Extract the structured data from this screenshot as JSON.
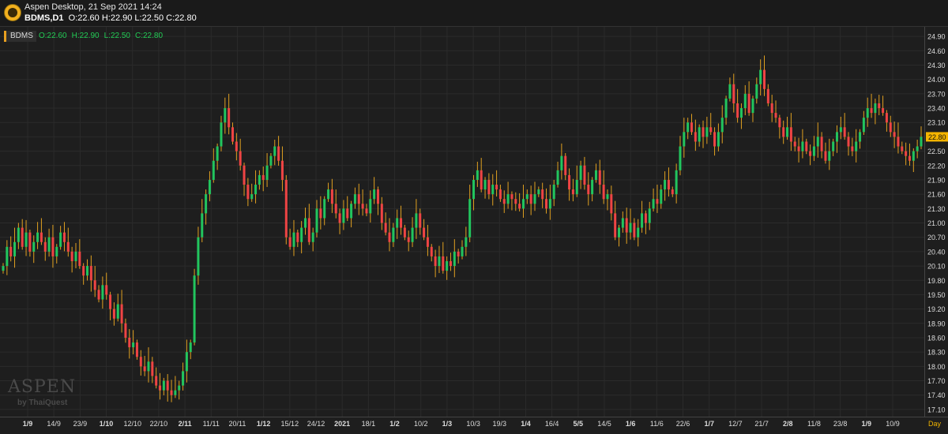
{
  "window": {
    "app_title": "Aspen Desktop, 21 Sep 2021 14:24",
    "symbol_tf": "BDMS,D1",
    "ohlc_text": "O:22.60 H:22.90 L:22.50 C:22.80"
  },
  "legend": {
    "symbol": "BDMS",
    "open": "O:22.60",
    "high": "H:22.90",
    "low": "L:22.50",
    "close": "C:22.80"
  },
  "watermark": {
    "brand": "ASPEN",
    "by": "by ThaiQuest"
  },
  "colors": {
    "up": "#22c55e",
    "down": "#ef4444",
    "wick": "#e0a020",
    "grid": "#2b2b2b",
    "last_price_bg": "#f5b400"
  },
  "chart_data": {
    "type": "candlestick",
    "title": "",
    "ylim": [
      16.95,
      25.1
    ],
    "y_ticks": [
      "24.90",
      "24.60",
      "24.30",
      "24.00",
      "23.70",
      "23.40",
      "23.10",
      "22.80",
      "22.50",
      "22.20",
      "21.90",
      "21.60",
      "21.30",
      "21.00",
      "20.70",
      "20.40",
      "20.10",
      "19.80",
      "19.50",
      "19.20",
      "18.90",
      "18.60",
      "18.30",
      "18.00",
      "17.70",
      "17.40",
      "17.10"
    ],
    "x_labels": [
      "1/9",
      "14/9",
      "23/9",
      "1/10",
      "12/10",
      "22/10",
      "2/11",
      "11/11",
      "20/11",
      "1/12",
      "15/12",
      "24/12",
      "2021",
      "18/1",
      "1/2",
      "10/2",
      "1/3",
      "10/3",
      "19/3",
      "1/4",
      "16/4",
      "5/5",
      "14/5",
      "1/6",
      "11/6",
      "22/6",
      "1/7",
      "12/7",
      "21/7",
      "2/8",
      "11/8",
      "23/8",
      "1/9",
      "10/9",
      "Day"
    ],
    "bold_labels": [
      "1/10",
      "2/11",
      "1/12",
      "2021",
      "1/2",
      "1/3",
      "1/4",
      "5/5",
      "1/6",
      "1/7",
      "2/8",
      "1/9"
    ],
    "last_price": "22.80",
    "closes": [
      20.1,
      20.5,
      20.3,
      20.6,
      20.9,
      20.5,
      20.8,
      20.4,
      20.6,
      20.8,
      20.6,
      20.4,
      20.7,
      20.3,
      20.5,
      20.8,
      20.6,
      20.4,
      20.2,
      20.4,
      20.1,
      19.9,
      20.1,
      19.8,
      19.6,
      19.4,
      19.7,
      19.5,
      19.2,
      19.0,
      19.3,
      18.9,
      18.6,
      18.4,
      18.5,
      18.2,
      18.0,
      17.9,
      18.1,
      17.8,
      17.6,
      17.5,
      17.7,
      17.5,
      17.4,
      17.5,
      17.6,
      17.9,
      18.3,
      18.5,
      19.9,
      20.7,
      21.2,
      21.6,
      21.9,
      22.3,
      22.6,
      23.1,
      23.4,
      23.0,
      22.7,
      22.5,
      22.2,
      21.8,
      21.5,
      21.6,
      21.8,
      22.0,
      21.9,
      22.2,
      22.4,
      22.6,
      22.3,
      21.9,
      20.7,
      20.5,
      20.8,
      20.6,
      20.9,
      21.1,
      20.6,
      20.8,
      21.3,
      21.1,
      21.5,
      21.7,
      21.4,
      21.2,
      21.0,
      21.3,
      21.1,
      21.4,
      21.6,
      21.4,
      21.3,
      21.2,
      21.5,
      21.7,
      21.4,
      21.0,
      20.8,
      20.6,
      20.9,
      21.1,
      20.9,
      20.7,
      20.6,
      20.9,
      21.2,
      20.9,
      20.7,
      20.5,
      20.3,
      20.1,
      20.3,
      20.0,
      20.2,
      20.1,
      20.4,
      20.3,
      20.5,
      20.7,
      21.5,
      21.9,
      22.1,
      21.7,
      21.9,
      21.6,
      21.8,
      21.7,
      21.5,
      21.4,
      21.6,
      21.5,
      21.4,
      21.3,
      21.5,
      21.6,
      21.4,
      21.6,
      21.7,
      21.5,
      21.3,
      21.5,
      21.8,
      22.1,
      22.4,
      22.0,
      21.7,
      21.6,
      21.9,
      22.2,
      21.8,
      21.6,
      21.9,
      22.1,
      21.8,
      21.5,
      21.6,
      21.2,
      20.7,
      20.9,
      21.1,
      20.8,
      21.0,
      20.7,
      20.9,
      21.2,
      21.0,
      21.3,
      21.5,
      21.4,
      21.7,
      21.9,
      21.7,
      21.6,
      22.1,
      22.6,
      22.9,
      23.1,
      22.9,
      22.7,
      23.0,
      22.8,
      23.0,
      22.9,
      22.6,
      22.9,
      23.2,
      23.6,
      23.9,
      23.5,
      23.2,
      23.4,
      23.7,
      23.3,
      23.6,
      23.9,
      24.2,
      23.8,
      23.5,
      23.3,
      23.2,
      23.0,
      22.8,
      23.0,
      22.7,
      22.6,
      22.5,
      22.7,
      22.5,
      22.4,
      22.6,
      22.8,
      22.5,
      22.3,
      22.5,
      22.7,
      22.9,
      23.0,
      22.8,
      22.6,
      22.5,
      22.7,
      22.9,
      23.2,
      23.4,
      23.3,
      23.5,
      23.4,
      23.3,
      23.1,
      22.9,
      22.8,
      22.6,
      22.5,
      22.4,
      22.3,
      22.5,
      22.6,
      22.8
    ]
  }
}
